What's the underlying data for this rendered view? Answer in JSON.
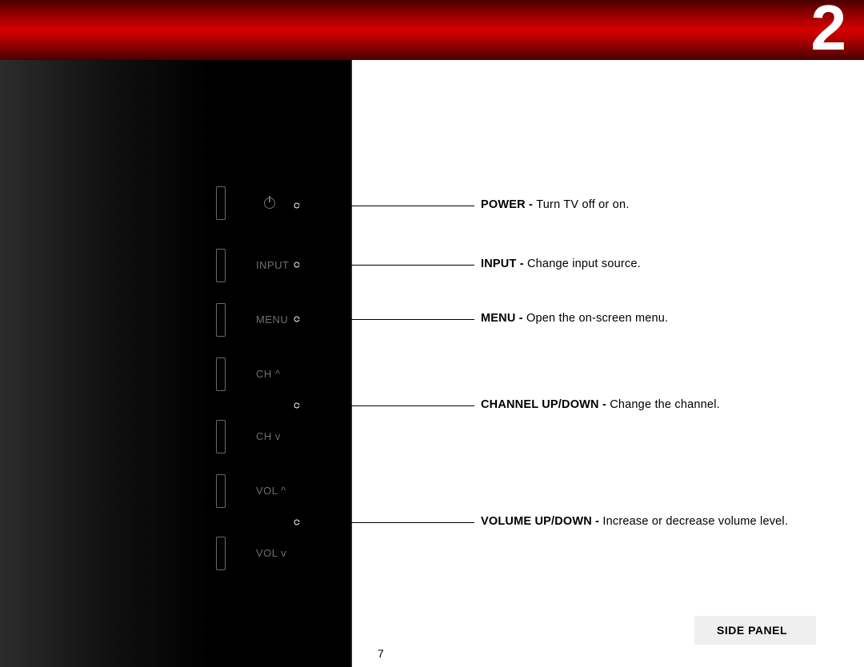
{
  "header": {
    "chapter_number": "2"
  },
  "panel": {
    "labels": {
      "input": "INPUT",
      "menu": "MENU",
      "ch_up": "CH ^",
      "ch_down": "CH v",
      "vol_up": "VOL ^",
      "vol_down": "VOL v"
    }
  },
  "callouts": {
    "power": {
      "label": "POWER - ",
      "desc": "Turn TV off or on."
    },
    "input": {
      "label": "INPUT - ",
      "desc": "Change input source."
    },
    "menu": {
      "label": "MENU - ",
      "desc": "Open the on-screen menu."
    },
    "channel": {
      "label": "CHANNEL UP/DOWN - ",
      "desc": "Change the channel."
    },
    "volume": {
      "label": "VOLUME UP/DOWN - ",
      "desc": "Increase or decrease volume level."
    }
  },
  "footer": {
    "section_tag": "SIDE PANEL",
    "page_number": "7"
  }
}
